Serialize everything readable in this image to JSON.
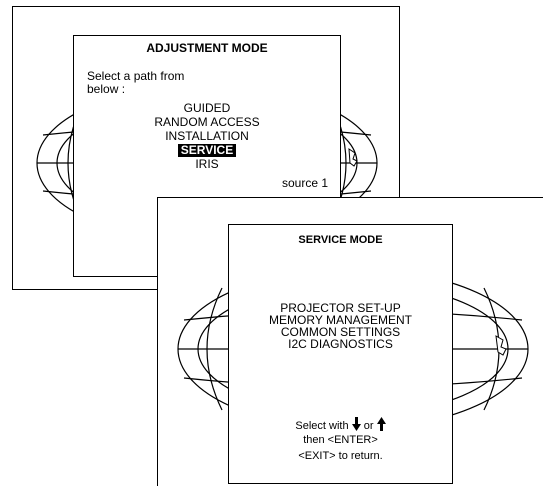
{
  "adjustment": {
    "title": "ADJUSTMENT MODE",
    "prompt_line1": "Select a path from",
    "prompt_line2": "below :",
    "items": [
      "GUIDED",
      "RANDOM ACCESS",
      "INSTALLATION",
      "SERVICE",
      "IRIS"
    ],
    "selected_item": "SERVICE",
    "source": "source 1"
  },
  "service": {
    "title": "SERVICE MODE",
    "items": [
      "PROJECTOR SET-UP",
      "MEMORY MANAGEMENT",
      "COMMON SETTINGS",
      "I2C DIAGNOSTICS"
    ],
    "hint_select_prefix": "Select with",
    "hint_or": "or",
    "hint_enter": "then <ENTER>",
    "hint_exit": "<EXIT> to return.",
    "icons": [
      "arrow-down-icon",
      "arrow-up-icon"
    ]
  }
}
